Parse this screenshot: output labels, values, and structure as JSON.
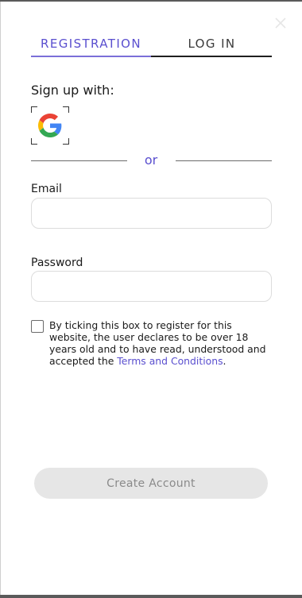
{
  "tabs": {
    "registration": "REGISTRATION",
    "login": "LOG IN",
    "active": "registration"
  },
  "signup": {
    "label": "Sign up with:",
    "providers": [
      {
        "name": "google-icon"
      }
    ]
  },
  "divider": {
    "text": "or"
  },
  "form": {
    "email": {
      "label": "Email",
      "value": "",
      "placeholder": ""
    },
    "password": {
      "label": "Password",
      "value": "",
      "placeholder": ""
    }
  },
  "consent": {
    "checked": false,
    "text_before": "By ticking this box to register for this website, the user declares to be over 18 years old and to have read, understood and accepted the ",
    "link_text": "Terms and Conditions",
    "text_after": "."
  },
  "submit": {
    "label": "Create Account",
    "enabled": false
  },
  "colors": {
    "accent": "#5a4fcf",
    "tab_underline": "#7b6fd8",
    "button_disabled_bg": "#e6e6e6",
    "button_disabled_text": "#8a8a8a"
  }
}
